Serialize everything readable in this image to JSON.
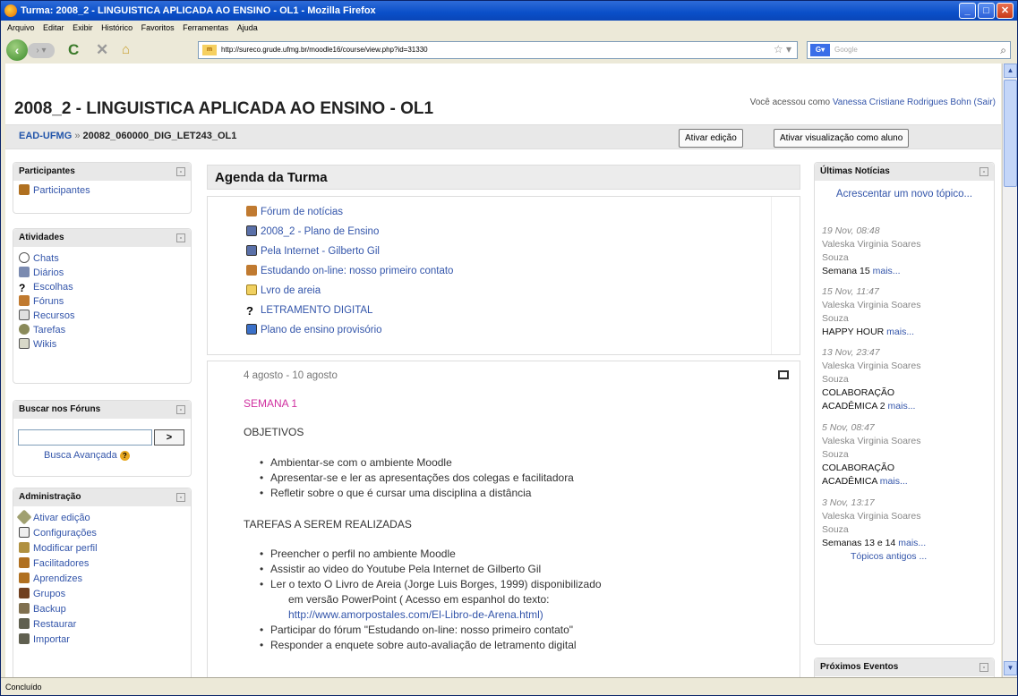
{
  "window": {
    "title": "Turma: 2008_2 - LINGUISTICA APLICADA AO ENSINO - OL1 - Mozilla Firefox",
    "status": "Concluído"
  },
  "menu": [
    "Arquivo",
    "Editar",
    "Exibir",
    "Histórico",
    "Favoritos",
    "Ferramentas",
    "Ajuda"
  ],
  "address": {
    "url": "http://sureco.grude.ufmg.br/moodle16/course/view.php?id=31330",
    "favicon": "m",
    "search_placeholder": "Google"
  },
  "page": {
    "title": "2008_2 - LINGUISTICA APLICADA AO ENSINO - OL1",
    "login_prefix": "Você acessou como",
    "user": "Vanessa Cristiane Rodrigues Bohn",
    "logout": "(Sair)",
    "breadcrumb_home": "EAD-UFMG",
    "breadcrumb_sep": "»",
    "breadcrumb_course": "20082_060000_DIG_LET243_OL1",
    "btn_edit": "Ativar edição",
    "btn_student": "Ativar visualização como aluno"
  },
  "left": {
    "participants": {
      "title": "Participantes",
      "items": [
        "Participantes"
      ]
    },
    "activities": {
      "title": "Atividades",
      "items": [
        "Chats",
        "Diários",
        "Escolhas",
        "Fóruns",
        "Recursos",
        "Tarefas",
        "Wikis"
      ]
    },
    "search": {
      "title": "Buscar nos Fóruns",
      "go": ">",
      "advanced": "Busca Avançada"
    },
    "admin": {
      "title": "Administração",
      "items": [
        "Ativar edição",
        "Configurações",
        "Modificar perfil",
        "Facilitadores",
        "Aprendizes",
        "Grupos",
        "Backup",
        "Restaurar",
        "Importar"
      ]
    }
  },
  "main": {
    "heading": "Agenda da Turma",
    "agenda": [
      "Fórum de notícias",
      "2008_2 - Plano de Ensino",
      "Pela Internet - Gilberto Gil",
      "Estudando on-line: nosso primeiro contato",
      "Lvro de areia",
      "LETRAMENTO DIGITAL",
      "Plano de ensino provisório"
    ],
    "week": {
      "date": "4 agosto - 10 agosto",
      "label": "SEMANA 1",
      "objectives_title": "OBJETIVOS",
      "objectives": [
        "Ambientar-se com o ambiente Moodle",
        "Apresentar-se e ler as apresentações dos colegas e facilitadora",
        "Refletir sobre o que é cursar uma disciplina a distância"
      ],
      "tasks_title": "TAREFAS A SEREM REALIZADAS",
      "tasks": [
        "Preencher o perfil no ambiente Moodle",
        "Assistir ao video do Youtube Pela Internet de Gilberto Gil"
      ],
      "task3_line1": "Ler o texto O Livro de Areia (Jorge Luis Borges, 1999) disponibilizado",
      "task3_line2": "em versão PowerPoint ( Acesso em espanhol do texto:",
      "task3_link": "http://www.amorpostales.com/El-Libro-de-Arena.html)",
      "task4": "Participar do fórum \"Estudando on-line: nosso primeiro contato\"",
      "task5": "Responder a enquete sobre auto-avaliação de letramento digital"
    }
  },
  "right": {
    "news_title": "Últimas Notícias",
    "add_topic": "Acrescentar um novo tópico...",
    "more": "mais...",
    "news": [
      {
        "date": "19 Nov, 08:48",
        "author1": "Valeska Virginia Soares",
        "author2": "Souza",
        "subject": "Semana 15"
      },
      {
        "date": "15 Nov, 11:47",
        "author1": "Valeska Virginia Soares",
        "author2": "Souza",
        "subject": "HAPPY HOUR"
      },
      {
        "date": "13 Nov, 23:47",
        "author1": "Valeska Virginia Soares",
        "author2": "Souza",
        "subject1": "COLABORAÇÃO",
        "subject": "ACADÊMICA 2"
      },
      {
        "date": "5 Nov, 08:47",
        "author1": "Valeska Virginia Soares",
        "author2": "Souza",
        "subject1": "COLABORAÇÃO",
        "subject": "ACADÊMICA"
      },
      {
        "date": "3 Nov, 13:17",
        "author1": "Valeska Virginia Soares",
        "author2": "Souza",
        "subject": "Semanas 13 e 14"
      }
    ],
    "older": "Tópicos antigos ...",
    "events_title": "Próximos Eventos"
  }
}
